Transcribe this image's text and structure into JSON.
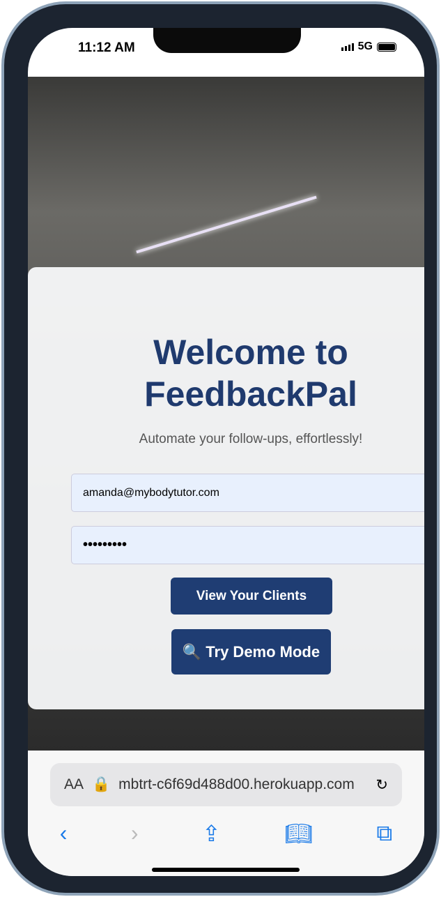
{
  "status": {
    "time": "11:12 AM",
    "network": "5G"
  },
  "card": {
    "title": "Welcome to FeedbackPal",
    "subtitle": "Automate your follow-ups, effortlessly!",
    "email": "amanda@mybodytutor.com",
    "password": "•••••••••",
    "view_clients": "View Your Clients",
    "demo_icon": "🔍",
    "demo": "Try Demo Mode"
  },
  "browser": {
    "aa": "AA",
    "url": "mbtrt-c6f69d488d00.herokuapp.com"
  },
  "colors": {
    "brand": "#1f3d73",
    "title": "#1f3a6e"
  }
}
